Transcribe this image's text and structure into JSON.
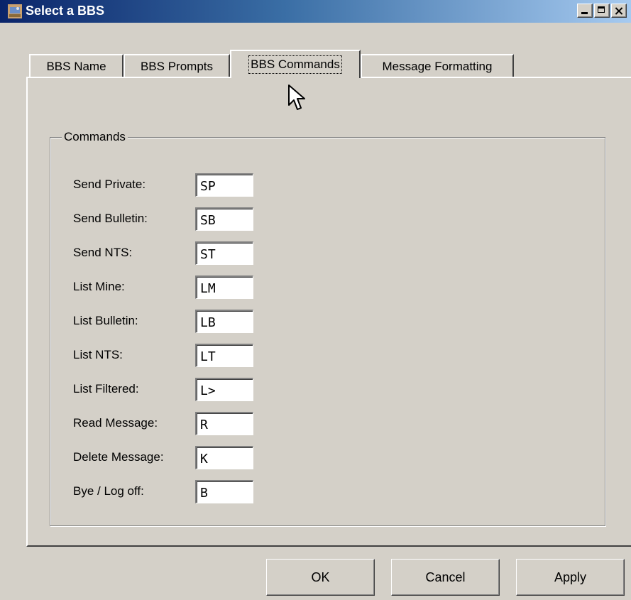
{
  "window": {
    "title": "Select a BBS",
    "icon": "app-icon",
    "caption_buttons": [
      "minimize-icon",
      "maximize-icon",
      "close-icon"
    ]
  },
  "tabs": [
    {
      "label": "BBS Name",
      "active": false
    },
    {
      "label": "BBS Prompts",
      "active": false
    },
    {
      "label": "BBS Commands",
      "active": true
    },
    {
      "label": "Message Formatting",
      "active": false
    }
  ],
  "commands_group": {
    "legend": "Commands",
    "rows": [
      {
        "label": "Send Private:",
        "value": "SP"
      },
      {
        "label": "Send Bulletin:",
        "value": "SB"
      },
      {
        "label": "Send NTS:",
        "value": "ST"
      },
      {
        "label": "List Mine:",
        "value": "LM"
      },
      {
        "label": "List Bulletin:",
        "value": "LB"
      },
      {
        "label": "List NTS:",
        "value": "LT"
      },
      {
        "label": "List Filtered:",
        "value": "L>"
      },
      {
        "label": "Read Message:",
        "value": "R"
      },
      {
        "label": "Delete Message:",
        "value": "K"
      },
      {
        "label": "Bye / Log off:",
        "value": "B"
      }
    ]
  },
  "buttons": {
    "ok": "OK",
    "cancel": "Cancel",
    "apply": "Apply"
  },
  "colors": {
    "face": "#d4d0c8",
    "title_start": "#0a246a",
    "title_end": "#a6caf0"
  }
}
